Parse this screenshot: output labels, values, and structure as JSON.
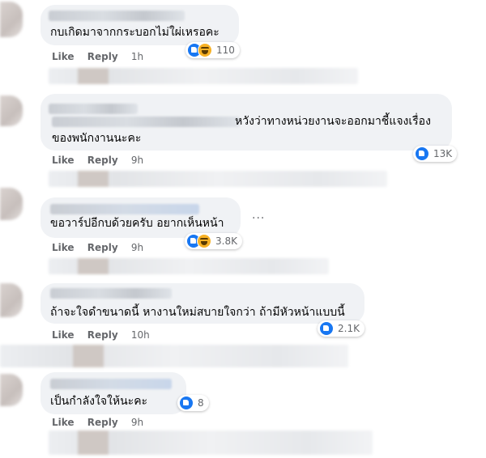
{
  "comments": [
    {
      "text_lines": [
        "กบเกิดมาจากกระบอกไม่ใผ่เหรอคะ"
      ],
      "actions": {
        "like": "Like",
        "reply": "Reply",
        "time": "1h"
      },
      "reactions": {
        "types": [
          "like-icon",
          "haha-icon"
        ],
        "count": "110"
      }
    },
    {
      "text_lines": [
        "หวังว่าทางหน่วยงานจะออกมาชี้แจงเรื่อง",
        "ของพนักงานนะคะ"
      ],
      "actions": {
        "like": "Like",
        "reply": "Reply",
        "time": "9h"
      },
      "reactions": {
        "types": [
          "like-icon"
        ],
        "count": "13K"
      }
    },
    {
      "text_lines": [
        "ขอวาร์ปอีกบด้วยครับ อยากเห็นหน้า"
      ],
      "actions": {
        "like": "Like",
        "reply": "Reply",
        "time": "9h"
      },
      "reactions": {
        "types": [
          "like-icon",
          "haha-icon"
        ],
        "count": "3.8K"
      },
      "more_label": "···"
    },
    {
      "text_lines": [
        "ถ้าจะใจดำขนาดนี้ หางานใหม่สบายใจกว่า ถ้ามีหัวหน้าแบบนี้"
      ],
      "actions": {
        "like": "Like",
        "reply": "Reply",
        "time": "10h"
      },
      "reactions": {
        "types": [
          "like-icon"
        ],
        "count": "2.1K"
      }
    },
    {
      "text_lines": [
        "เป็นกำลังใจให้นะคะ"
      ],
      "actions": {
        "like": "Like",
        "reply": "Reply",
        "time": "9h"
      },
      "reactions": {
        "types": [
          "like-icon"
        ],
        "count": "8"
      }
    }
  ],
  "colors": {
    "bubble": "#f0f2f5",
    "like_blue": "#1877f2",
    "haha_yellow": "#f7b125",
    "meta_gray": "#65676b"
  }
}
